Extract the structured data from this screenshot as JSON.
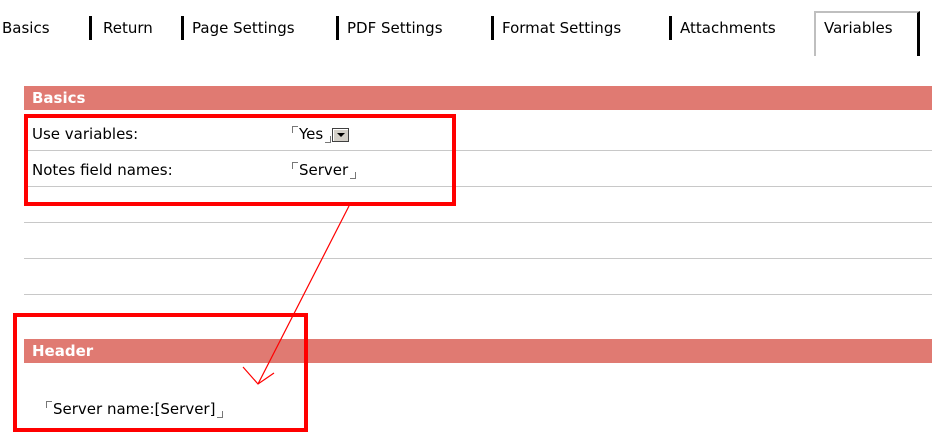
{
  "tabs": [
    {
      "label": "Basics"
    },
    {
      "label": "Return"
    },
    {
      "label": "Page Settings"
    },
    {
      "label": "PDF Settings"
    },
    {
      "label": "Format Settings"
    },
    {
      "label": "Attachments"
    },
    {
      "label": "Variables",
      "active": true
    }
  ],
  "basics": {
    "title": "Basics",
    "use_variables": {
      "label": "Use variables:",
      "value": "Yes"
    },
    "notes_field_names": {
      "label": "Notes field names:",
      "value": "Server"
    }
  },
  "header": {
    "title": "Header",
    "field_value": "Server name:[Server]"
  },
  "colors": {
    "section_bar": "#e07a72",
    "annotation": "#ff0000"
  }
}
